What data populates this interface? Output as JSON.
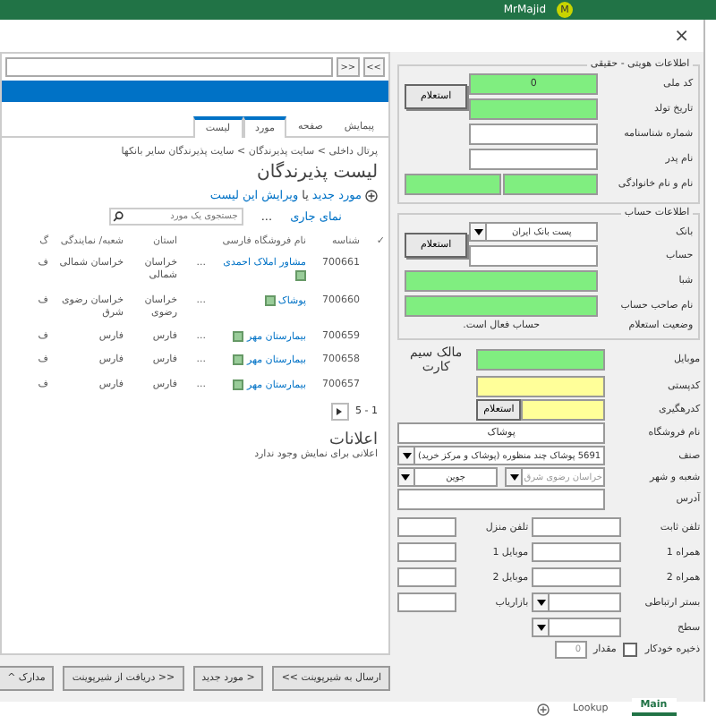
{
  "excel_bar": {
    "user": "MrMajid",
    "avatar": "M"
  },
  "dialog": {
    "close": "×"
  },
  "browser": {
    "nav_buttons": [
      ">>",
      "<<"
    ],
    "tabs": [
      {
        "label": "پیمایش",
        "selected": false
      },
      {
        "label": "صفحه",
        "selected": false
      },
      {
        "label": "مورد",
        "selected": true
      },
      {
        "label": "لیست",
        "selected": true
      }
    ],
    "breadcrumb": "پرتال داخلی > سایت پذیرندگان > سایت پذیرندگان سایر بانکها",
    "title": "لیست پذیرندگان",
    "new_item": "مورد جدید",
    "or": "یا",
    "edit_link": "ویرایش این لیست",
    "view": "نمای جاری",
    "more": "...",
    "search": {
      "placeholder": "جستجوی یک مورد"
    },
    "table": {
      "columns": [
        "✓",
        "شناسه",
        "نام فروشگاه فارسی",
        "",
        "استان",
        "شعبه/ نمایندگی",
        "گ"
      ],
      "rows": [
        {
          "id": "700661",
          "name": "مشاور املاک احمدی",
          "menu": "...",
          "province": "خراسان شمالی",
          "branch": "خراسان شمالی",
          "column_6": "ف"
        },
        {
          "id": "700660",
          "name": "پوشاک",
          "menu": "...",
          "province": "خراسان رضوی",
          "branch": "خراسان رضوی شرق",
          "column_6": "ف"
        },
        {
          "id": "700659",
          "name": "بیمارستان مهر",
          "menu": "...",
          "province": "فارس",
          "branch": "فارس",
          "column_6": "ف"
        },
        {
          "id": "700658",
          "name": "بیمارستان مهر",
          "menu": "...",
          "province": "فارس",
          "branch": "فارس",
          "column_6": "ف"
        },
        {
          "id": "700657",
          "name": "بیمارستان مهر",
          "menu": "...",
          "province": "فارس",
          "branch": "فارس",
          "column_6": "ف"
        }
      ]
    },
    "pager": {
      "range": "1 - 5"
    },
    "announcements": {
      "title": "اعلانات",
      "text": "اعلانی برای نمایش وجود ندارد"
    }
  },
  "buttons": [
    "ارسال به شیرپوینت >>",
    "< مورد جدید",
    "<< دریافت از شیرپوینت",
    "مدارک ^"
  ],
  "identity": {
    "legend": "اطلاعات هویتی - حقیقی",
    "button": "استعلام",
    "fields": [
      {
        "kind": "single",
        "label": "کد ملی",
        "value": "0",
        "color": "#80ee80"
      },
      {
        "kind": "single",
        "label": "تاریخ تولد",
        "color": "#80ee80"
      },
      {
        "kind": "single",
        "label": "شماره شناسنامه",
        "color": "#ffffff"
      },
      {
        "kind": "single",
        "label": "نام پدر",
        "color": "#ffffff"
      },
      {
        "kind": "double",
        "label": "نام و نام خانوادگی",
        "color": "#80ee80"
      }
    ]
  },
  "account": {
    "legend": "اطلاعات حساب",
    "button": "استعلام",
    "bank": {
      "label": "بانک",
      "value": "پست بانک ایران"
    },
    "fields": [
      {
        "kind": "single",
        "label": "حساب",
        "color": "#ffffff"
      },
      {
        "kind": "wide",
        "label": "شبا",
        "color": "#80ee80"
      },
      {
        "kind": "wide",
        "label": "نام صاحب حساب",
        "color": "#80ee80"
      }
    ],
    "status": {
      "label": "وضعیت استعلام",
      "value": "حساب فعال است."
    }
  },
  "mobile": {
    "label": "موبایل",
    "color": "#80ee80",
    "note": "مالک سیم کارت"
  },
  "postal_code": {
    "label": "کدپستی",
    "color": "#ffff99"
  },
  "tracking_code": {
    "label": "کدرهگیری",
    "color": "#ffff99",
    "button": "استعلام"
  },
  "store_name": {
    "label": "نام فروشگاه",
    "value": "پوشاک"
  },
  "guild": {
    "label": "صنف",
    "value": "5691 پوشاک چند منظوره (پوشاک و مرکز خرید)"
  },
  "branch_city": {
    "label": "شعبه و شهر",
    "branch": {
      "value": "خراسان رضوی شرق",
      "disabled": true
    },
    "city": {
      "value": "جوین",
      "disabled": false
    }
  },
  "address": {
    "label": "آدرس"
  },
  "phones": [
    {
      "label": "تلفن ثابت",
      "kind": "field",
      "other_label": "تلفن منزل"
    },
    {
      "label": "همراه 1",
      "kind": "field",
      "other_label": "موبایل 1"
    },
    {
      "label": "همراه 2",
      "kind": "field",
      "other_label": "موبایل 2"
    },
    {
      "label": "بستر ارتباطی",
      "kind": "dropdown",
      "other_label": "بازاریاب"
    }
  ],
  "level": {
    "label": "سطح"
  },
  "autosave": {
    "label": "ذخیره خودکار",
    "checked": false,
    "amount_label": "مقدار",
    "amount": "0"
  },
  "sheet_tabs": [
    {
      "label": "Lookup",
      "selected": false
    },
    {
      "label": "Main",
      "selected": true
    }
  ]
}
